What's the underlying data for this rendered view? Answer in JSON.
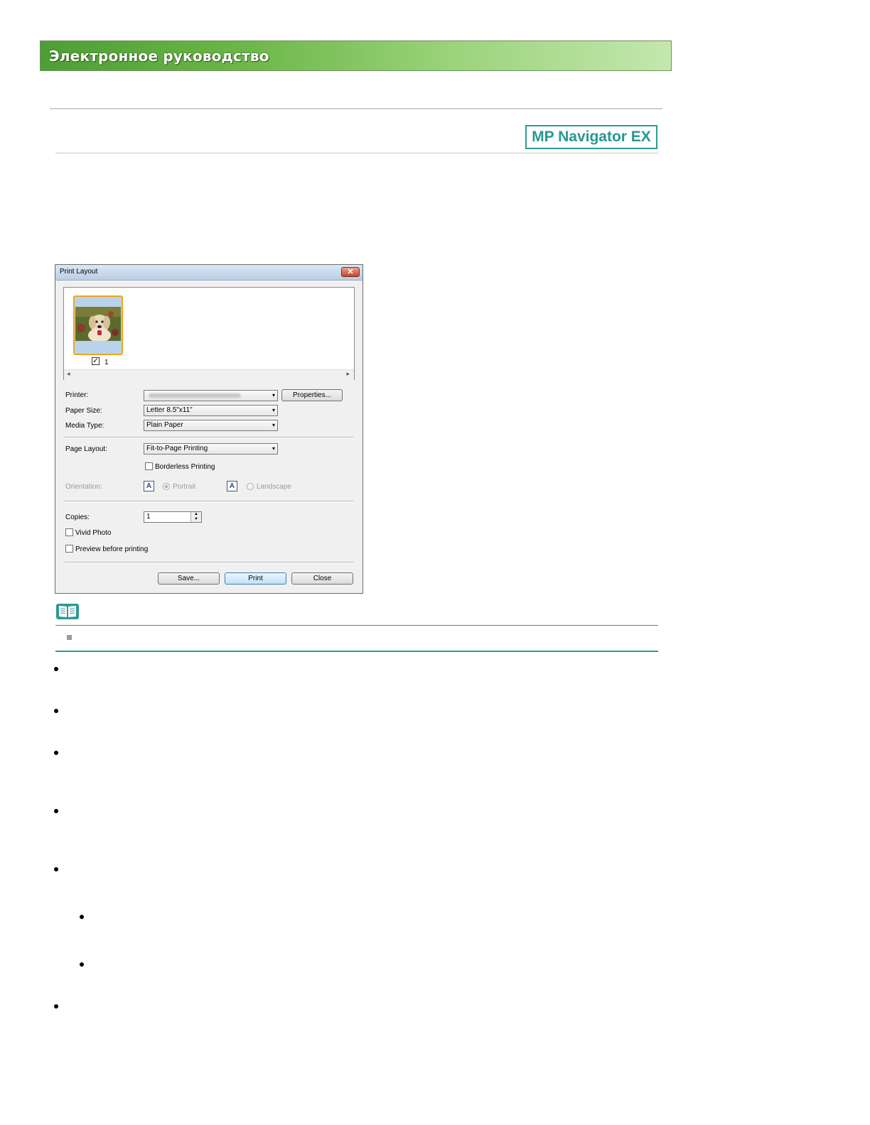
{
  "header": {
    "title": "Электронное руководство"
  },
  "logo": {
    "text": "MP Navigator EX"
  },
  "dialog": {
    "title": "Print Layout",
    "close_glyph": "✕",
    "thumbnail": {
      "checkbox_glyph": "✓",
      "number": "1",
      "scroll_left": "◂",
      "scroll_right": "▸"
    },
    "labels": {
      "printer": "Printer:",
      "paper_size": "Paper Size:",
      "media_type": "Media Type:",
      "page_layout": "Page Layout:",
      "orientation": "Orientation:",
      "copies": "Copies:"
    },
    "values": {
      "paper_size": "Letter 8.5\"x11\"",
      "media_type": "Plain Paper",
      "page_layout": "Fit-to-Page Printing",
      "copies": "1"
    },
    "properties_button": "Properties...",
    "borderless": "Borderless Printing",
    "portrait": "Portrait",
    "landscape": "Landscape",
    "orient_glyph": "A",
    "vivid_photo": "Vivid Photo",
    "preview_before_printing": "Preview before printing",
    "buttons": {
      "save": "Save...",
      "print": "Print",
      "close": "Close"
    },
    "arrow_glyph": "▾",
    "spin_up": "▲",
    "spin_down": "▼"
  }
}
